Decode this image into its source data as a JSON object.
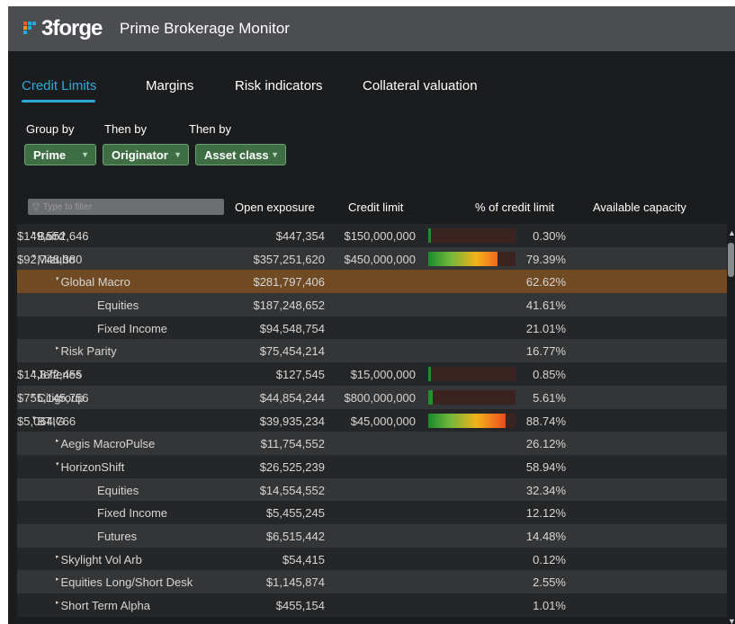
{
  "app": {
    "logo_text": "3forge",
    "title": "Prime Brokerage Monitor",
    "logo_colors": [
      "#f15a24",
      "#27aae1",
      "#27aae1",
      "#f7931e",
      "#27aae1",
      "#27aae1"
    ]
  },
  "tabs": [
    {
      "label": "Credit Limits",
      "active": true
    },
    {
      "label": "Margins",
      "active": false
    },
    {
      "label": "Risk indicators",
      "active": false
    },
    {
      "label": "Collateral valuation",
      "active": false
    }
  ],
  "grouping": {
    "labels": [
      "Group by",
      "Then by",
      "Then by"
    ],
    "selects": [
      {
        "value": "Prime"
      },
      {
        "value": "Originator"
      },
      {
        "value": "Asset class"
      }
    ]
  },
  "table": {
    "filter_placeholder": "Type to filter",
    "columns": [
      "Open exposure",
      "Credit limit",
      "% of credit limit",
      "Available capacity"
    ],
    "rows": [
      {
        "name": "Baird",
        "level": 0,
        "caret": "right",
        "exposure": "$447,354",
        "limit": "$150,000,000",
        "pct": "0.30%",
        "bar": 0.003,
        "capacity": "$149,552,646"
      },
      {
        "name": "Mizuho",
        "level": 0,
        "caret": "down",
        "exposure": "$357,251,620",
        "limit": "$450,000,000",
        "pct": "79.39%",
        "bar": 0.7939,
        "capacity": "$92,748,380"
      },
      {
        "name": "Global Macro",
        "level": 1,
        "caret": "down",
        "exposure": "$281,797,406",
        "limit": "",
        "pct": "62.62%",
        "capacity": "",
        "selected": true
      },
      {
        "name": "Equities",
        "level": 2,
        "caret": "",
        "exposure": "$187,248,652",
        "limit": "",
        "pct": "41.61%",
        "capacity": ""
      },
      {
        "name": "Fixed Income",
        "level": 2,
        "caret": "",
        "exposure": "$94,548,754",
        "limit": "",
        "pct": "21.01%",
        "capacity": ""
      },
      {
        "name": "Risk Parity",
        "level": 1,
        "caret": "right",
        "exposure": "$75,454,214",
        "limit": "",
        "pct": "16.77%",
        "capacity": ""
      },
      {
        "name": "Jefferies",
        "level": 0,
        "caret": "right",
        "exposure": "$127,545",
        "limit": "$15,000,000",
        "pct": "0.85%",
        "bar": 0.0085,
        "capacity": "$14,872,455"
      },
      {
        "name": "Citigroup",
        "level": 0,
        "caret": "right",
        "exposure": "$44,854,244",
        "limit": "$800,000,000",
        "pct": "5.61%",
        "bar": 0.0561,
        "capacity": "$755,145,756"
      },
      {
        "name": "BTIG",
        "level": 0,
        "caret": "down",
        "exposure": "$39,935,234",
        "limit": "$45,000,000",
        "pct": "88.74%",
        "bar": 0.8874,
        "capacity": "$5,064,766"
      },
      {
        "name": "Aegis MacroPulse",
        "level": 1,
        "caret": "right",
        "exposure": "$11,754,552",
        "limit": "",
        "pct": "26.12%",
        "capacity": ""
      },
      {
        "name": "HorizonShift",
        "level": 1,
        "caret": "down",
        "exposure": "$26,525,239",
        "limit": "",
        "pct": "58.94%",
        "capacity": ""
      },
      {
        "name": "Equities",
        "level": 2,
        "caret": "",
        "exposure": "$14,554,552",
        "limit": "",
        "pct": "32.34%",
        "capacity": ""
      },
      {
        "name": "Fixed Income",
        "level": 2,
        "caret": "",
        "exposure": "$5,455,245",
        "limit": "",
        "pct": "12.12%",
        "capacity": ""
      },
      {
        "name": "Futures",
        "level": 2,
        "caret": "",
        "exposure": "$6,515,442",
        "limit": "",
        "pct": "14.48%",
        "capacity": ""
      },
      {
        "name": "Skylight Vol Arb",
        "level": 1,
        "caret": "right",
        "exposure": "$54,415",
        "limit": "",
        "pct": "0.12%",
        "capacity": ""
      },
      {
        "name": "Equities Long/Short Desk",
        "level": 1,
        "caret": "right",
        "exposure": "$1,145,874",
        "limit": "",
        "pct": "2.55%",
        "capacity": ""
      },
      {
        "name": "Short Term Alpha",
        "level": 1,
        "caret": "right",
        "exposure": "$455,154",
        "limit": "",
        "pct": "1.01%",
        "capacity": ""
      }
    ]
  },
  "colors": {
    "accent": "#2fa8d8",
    "selected_row": "#6f4a22",
    "select_bg": "#3f6e45"
  }
}
